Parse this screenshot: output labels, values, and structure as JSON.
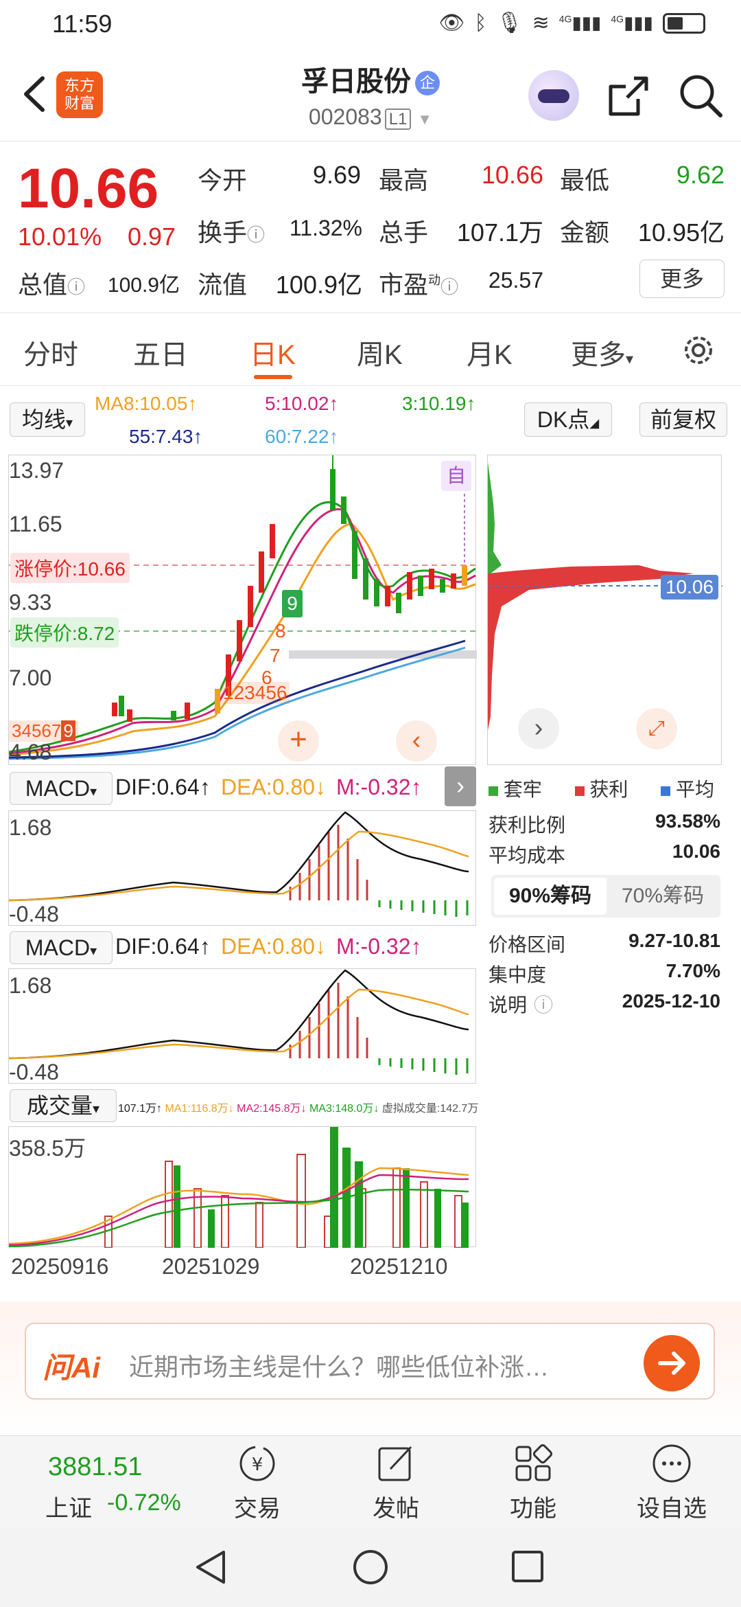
{
  "status_bar": {
    "time": "11:59",
    "signal_labels": [
      "4G",
      "4G"
    ]
  },
  "header": {
    "logo_text_1": "东方",
    "logo_text_2": "财富",
    "stock_name": "孚日股份",
    "badge": "企",
    "stock_code": "002083",
    "market_level": "L1"
  },
  "quote": {
    "price": "10.66",
    "change_pct": "10.01%",
    "change_amt": "0.97",
    "open_label": "今开",
    "open_value": "9.69",
    "high_label": "最高",
    "high_value": "10.66",
    "low_label": "最低",
    "low_value": "9.62",
    "turnover_label": "换手",
    "turnover_value": "11.32%",
    "volume_label": "总手",
    "volume_value": "107.1万",
    "amount_label": "金额",
    "amount_value": "10.95亿",
    "mktcap_label": "总值",
    "mktcap_value": "100.9亿",
    "float_label": "流值",
    "float_value": "100.9亿",
    "pe_label": "市盈",
    "pe_sup": "动",
    "pe_value": "25.57",
    "more_button": "更多"
  },
  "tabs": {
    "items": [
      "分时",
      "五日",
      "日K",
      "周K",
      "月K",
      "更多"
    ],
    "active": "日K"
  },
  "indicators": {
    "ma_button": "均线",
    "ma8": "MA8:10.05↑",
    "ma5": "5:10.02↑",
    "ma3": "3:10.19↑",
    "ma55": "55:7.43↑",
    "ma60": "60:7.22↑",
    "dk_button": "DK点",
    "adjust_button": "前复权"
  },
  "kline": {
    "y_labels": [
      "13.97",
      "11.65",
      "9.33",
      "7.00",
      "4.68"
    ],
    "limit_up": "涨停价:10.66",
    "limit_down": "跌停价:8.72",
    "self_tag": "自",
    "count_marks": [
      "9",
      "8",
      "7",
      "6",
      "1",
      "2",
      "3",
      "4",
      "5",
      "6",
      "3",
      "4",
      "5",
      "6",
      "7",
      "9"
    ]
  },
  "macd_panels": [
    {
      "selector": "MACD",
      "dif": "DIF:0.64↑",
      "dea": "DEA:0.80↓",
      "m": "M:-0.32↑",
      "y_top": "1.68",
      "y_bottom": "-0.48"
    },
    {
      "selector": "MACD",
      "dif": "DIF:0.64↑",
      "dea": "DEA:0.80↓",
      "m": "M:-0.32↑",
      "y_top": "1.68",
      "y_bottom": "-0.48"
    }
  ],
  "volume": {
    "selector": "成交量",
    "info": "107.1万↑",
    "ma1": "MA1:116.8万↓",
    "ma2": "MA2:145.8万↓",
    "ma3": "MA3:148.0万↓",
    "virtual": "虚拟成交量:142.7万",
    "y_top": "358.5万",
    "dates": [
      "20250916",
      "20251029",
      "20251210"
    ]
  },
  "chip_panel": {
    "price_tag": "10.06",
    "legend": [
      "套牢",
      "获利",
      "平均"
    ],
    "legend_colors": [
      "#3aa83a",
      "#e03a3a",
      "#3a78d8"
    ],
    "profit_ratio_label": "获利比例",
    "profit_ratio_value": "93.58%",
    "avg_cost_label": "平均成本",
    "avg_cost_value": "10.06",
    "seg_on": "90%筹码",
    "seg_off": "70%筹码",
    "range_label": "价格区间",
    "range_value": "9.27-10.81",
    "concentration_label": "集中度",
    "concentration_value": "7.70%",
    "note_label": "说明",
    "note_value": "2025-12-10"
  },
  "ai_bar": {
    "logo": "问Ai",
    "placeholder": "近期市场主线是什么？哪些低位补涨…"
  },
  "bottom_nav": {
    "index_value": "3881.51",
    "index_name": "上证",
    "index_change": "-0.72%",
    "items": [
      "交易",
      "发帖",
      "功能",
      "设自选"
    ]
  },
  "colors": {
    "up": "#e02020",
    "down": "#1e9e1e",
    "accent": "#f05a1a"
  }
}
